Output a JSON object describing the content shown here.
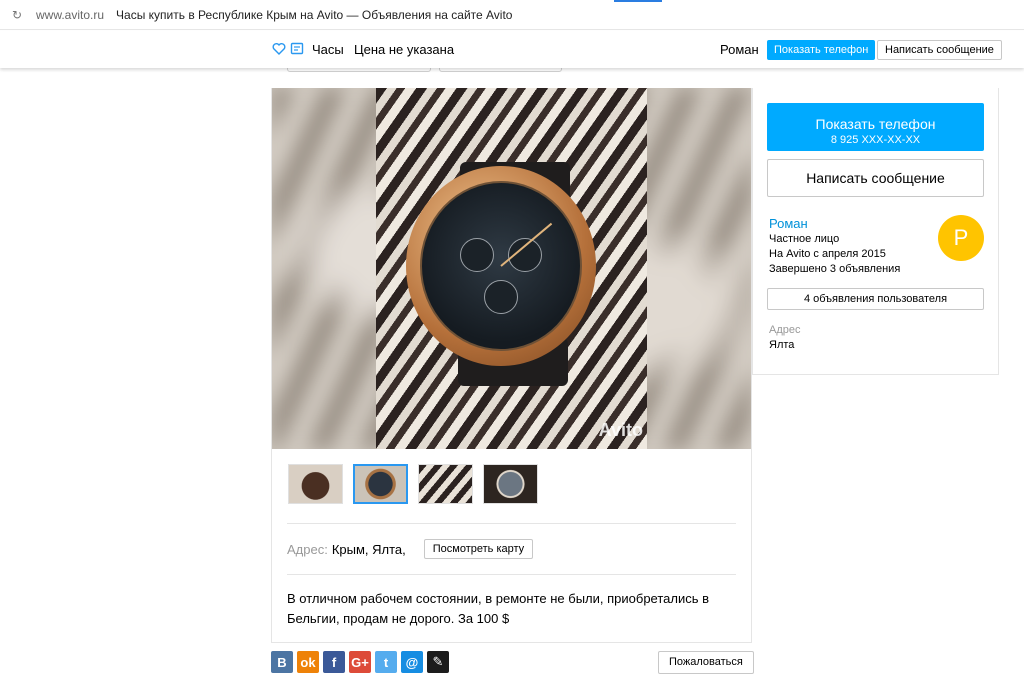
{
  "browser": {
    "domain": "www.avito.ru",
    "title": "Часы купить в Республике Крым на Avito — Объявления на сайте Avito"
  },
  "sticky_header": {
    "title": "Часы",
    "price": "Цена не указана",
    "seller": "Роман",
    "show_phone_label": "Показать телефон",
    "write_message_label": "Написать сообщение"
  },
  "gallery": {
    "watermark": "Avito",
    "thumbnails_count": 4,
    "active_thumbnail": 2
  },
  "address": {
    "label": "Адрес:",
    "value": "Крым, Ялта,",
    "map_button": "Посмотреть карту"
  },
  "description": "В отличном рабочем состоянии, в ремонте не были, приобретались в Бельгии, продам не дорого. За 100 $",
  "share": {
    "icons": [
      "vk-icon",
      "odnoklassniki-icon",
      "facebook-icon",
      "google-plus-icon",
      "twitter-icon",
      "mail-icon",
      "livejournal-icon"
    ],
    "labels": [
      "B",
      "ok",
      "f",
      "G+",
      "t",
      "@",
      "✎"
    ],
    "colors": [
      "#4c75a3",
      "#ee8208",
      "#3b5998",
      "#dd4b39",
      "#55acee",
      "#168de2",
      "#1c1c1c"
    ]
  },
  "complain_label": "Пожаловаться",
  "sidebar": {
    "show_phone_label": "Показать телефон",
    "phone_masked": "8 925 XXX-XX-XX",
    "write_message_label": "Написать сообщение",
    "seller_name": "Роман",
    "seller_type": "Частное лицо",
    "on_avito_since": "На Avito с апреля 2015",
    "completed": "Завершено 3 объявления",
    "avatar_letter": "Р",
    "avatar_color": "#ffc400",
    "user_ads_label": "4 объявления пользователя",
    "address_label": "Адрес",
    "address_value": "Ялта"
  },
  "colors": {
    "accent": "#00aaff",
    "link": "#0091d9"
  }
}
